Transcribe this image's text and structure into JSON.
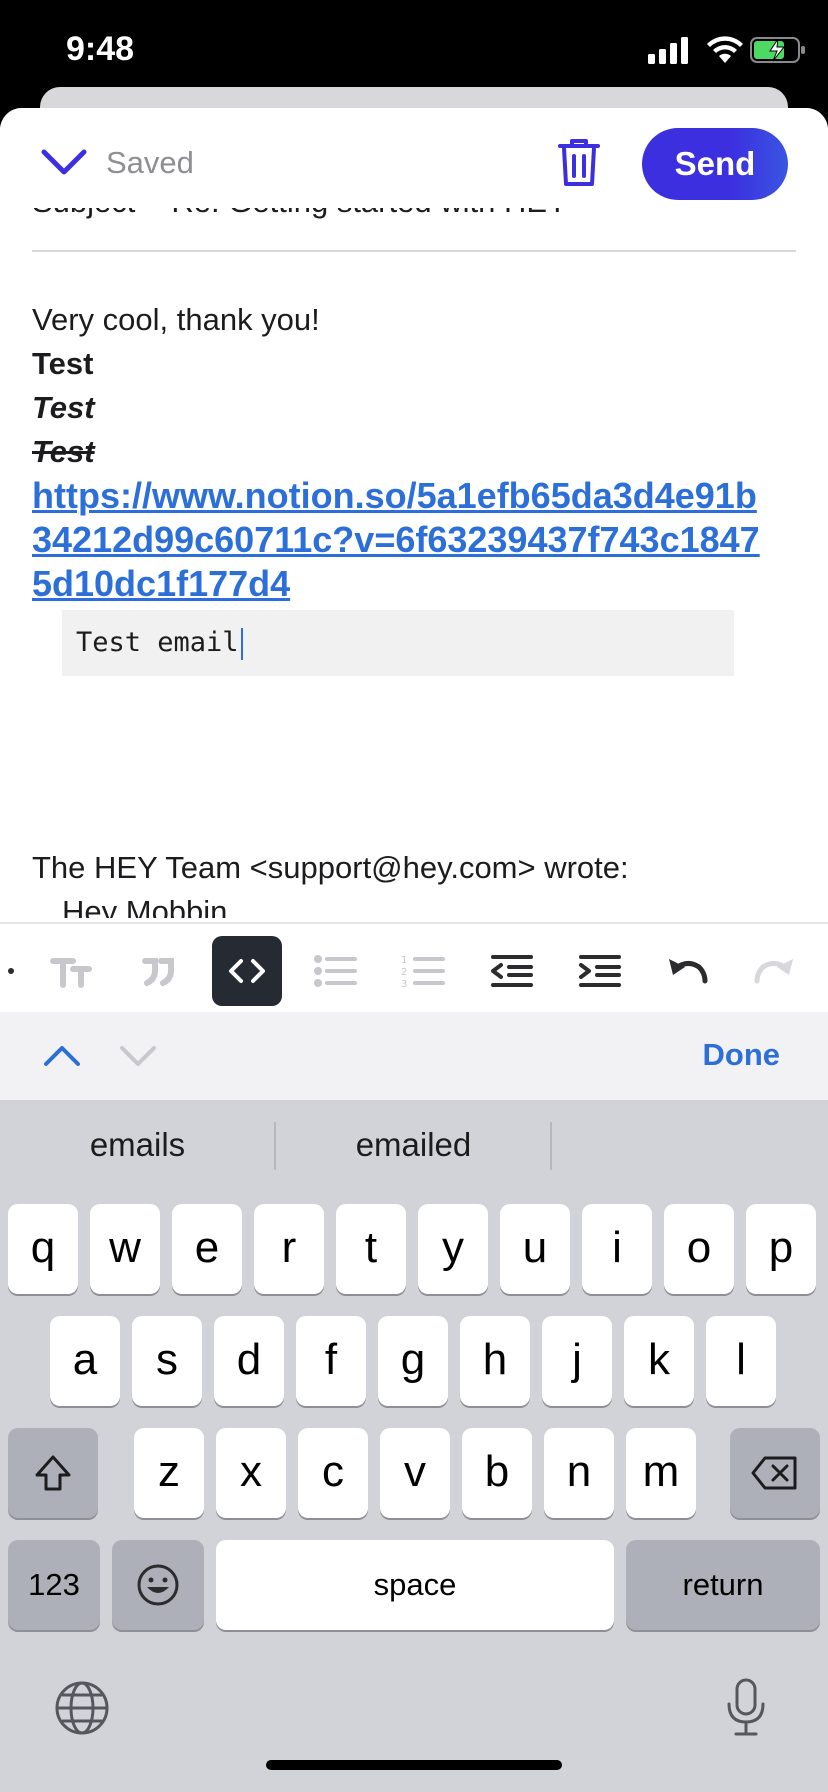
{
  "status_bar": {
    "time": "9:48"
  },
  "topbar": {
    "saved_label": "Saved",
    "send_label": "Send"
  },
  "subject": {
    "label": "Subject",
    "value": "Re: Getting started with HEY"
  },
  "body": {
    "line1": "Very cool, thank you!",
    "bold": "Test",
    "italic": "Test",
    "strike": "Test",
    "link": "https://www.notion.so/5a1efb65da3d4e91b34212d99c60711c?v=6f63239437f743c18475d10dc1f177d4",
    "code": "Test email",
    "quote_header": "The HEY Team <support@hey.com> wrote:",
    "quote_line": "Hey Mobbin,"
  },
  "accessory": {
    "done_label": "Done"
  },
  "keyboard": {
    "suggestions": [
      "emails",
      "emailed"
    ],
    "row1": [
      "q",
      "w",
      "e",
      "r",
      "t",
      "y",
      "u",
      "i",
      "o",
      "p"
    ],
    "row2": [
      "a",
      "s",
      "d",
      "f",
      "g",
      "h",
      "j",
      "k",
      "l"
    ],
    "row3": [
      "z",
      "x",
      "c",
      "v",
      "b",
      "n",
      "m"
    ],
    "numbers_label": "123",
    "space_label": "space",
    "return_label": "return"
  },
  "colors": {
    "accent": "#3c2fe0",
    "link": "#2d6fd8",
    "keyboard_bg": "#d1d3d9"
  }
}
